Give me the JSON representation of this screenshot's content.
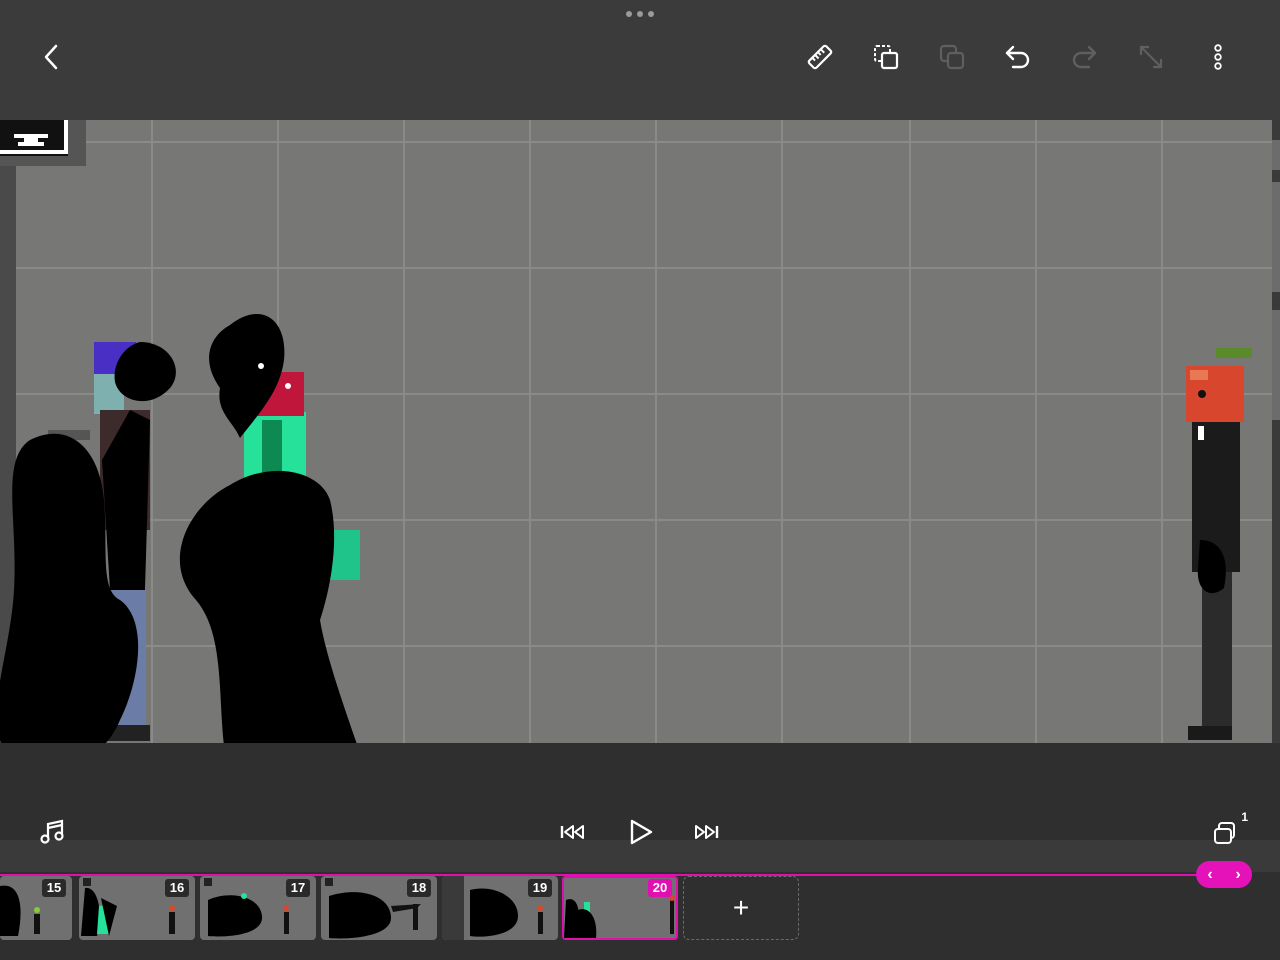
{
  "toolbar": {
    "back": "chevron-left-icon",
    "actions": [
      "ruler-icon",
      "duplicate-icon",
      "layers-disabled-icon",
      "undo-icon",
      "redo-disabled-icon",
      "resize-disabled-icon",
      "more-vertical-icon"
    ]
  },
  "playback": {
    "music": "music-note-icon",
    "skip_start": "skip-to-start-icon",
    "play": "play-icon",
    "skip_end": "skip-to-end-icon",
    "onion_skin_count": "1"
  },
  "timeline": {
    "frames": [
      "15",
      "16",
      "17",
      "18",
      "19",
      "20"
    ],
    "active_frame": "20",
    "add_frame_label": "+",
    "scrub_prev": "‹",
    "scrub_next": "›"
  },
  "colors": {
    "accent": "#e010b0",
    "stage": "#777876",
    "chrome": "#3b3b3b"
  }
}
